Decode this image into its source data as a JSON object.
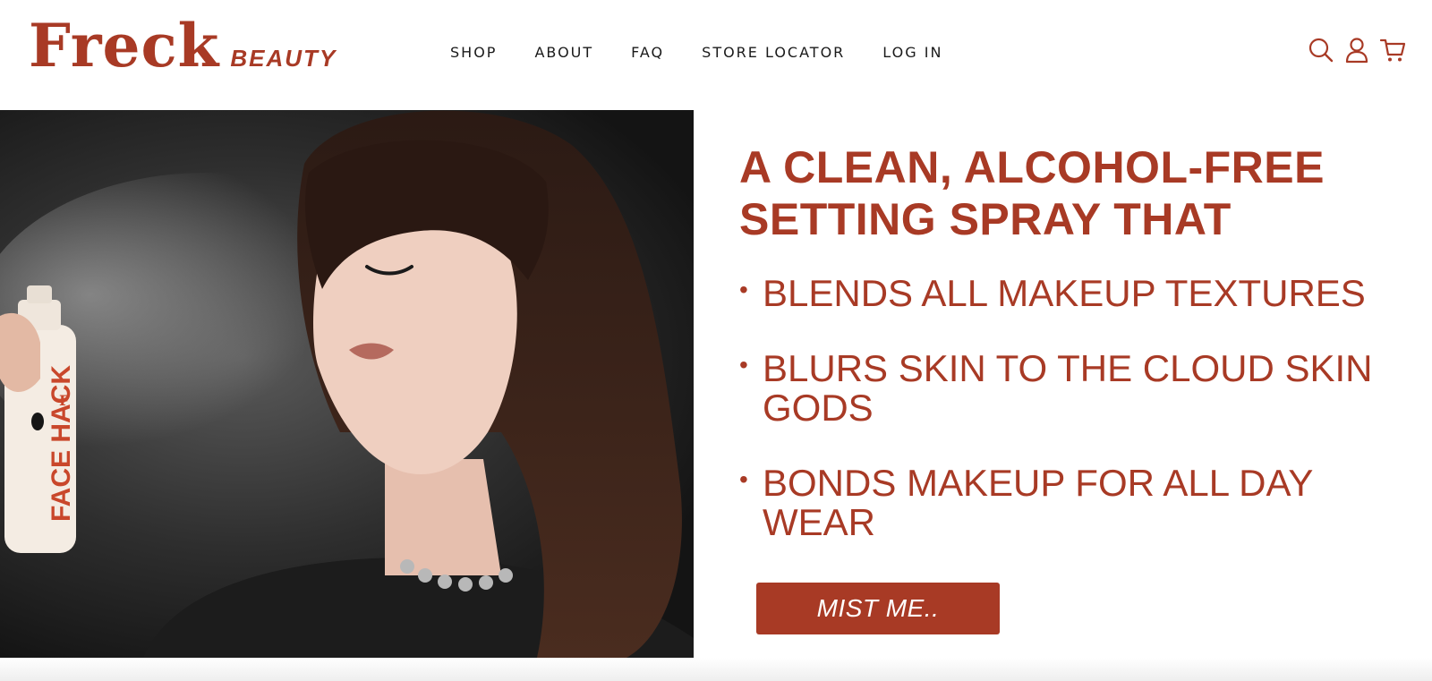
{
  "brand": {
    "name": "Freck",
    "sub": "BEAUTY",
    "accent_color": "#a83a25"
  },
  "nav": {
    "items": [
      {
        "label": "SHOP"
      },
      {
        "label": "ABOUT"
      },
      {
        "label": "FAQ"
      },
      {
        "label": "STORE LOCATOR"
      },
      {
        "label": "LOG IN"
      }
    ]
  },
  "header_icons": [
    "search-icon",
    "account-icon",
    "cart-icon"
  ],
  "hero": {
    "headline": "A CLEAN, ALCOHOL-FREE SETTING SPRAY THAT",
    "bullets": [
      "BLENDS ALL MAKEUP TEXTURES",
      "BLURS SKIN TO THE CLOUD SKIN GODS",
      "BONDS MAKEUP FOR ALL DAY WEAR"
    ],
    "cta_label": "MIST ME..",
    "product_label": "FACE HACK",
    "product_mark": "F"
  }
}
